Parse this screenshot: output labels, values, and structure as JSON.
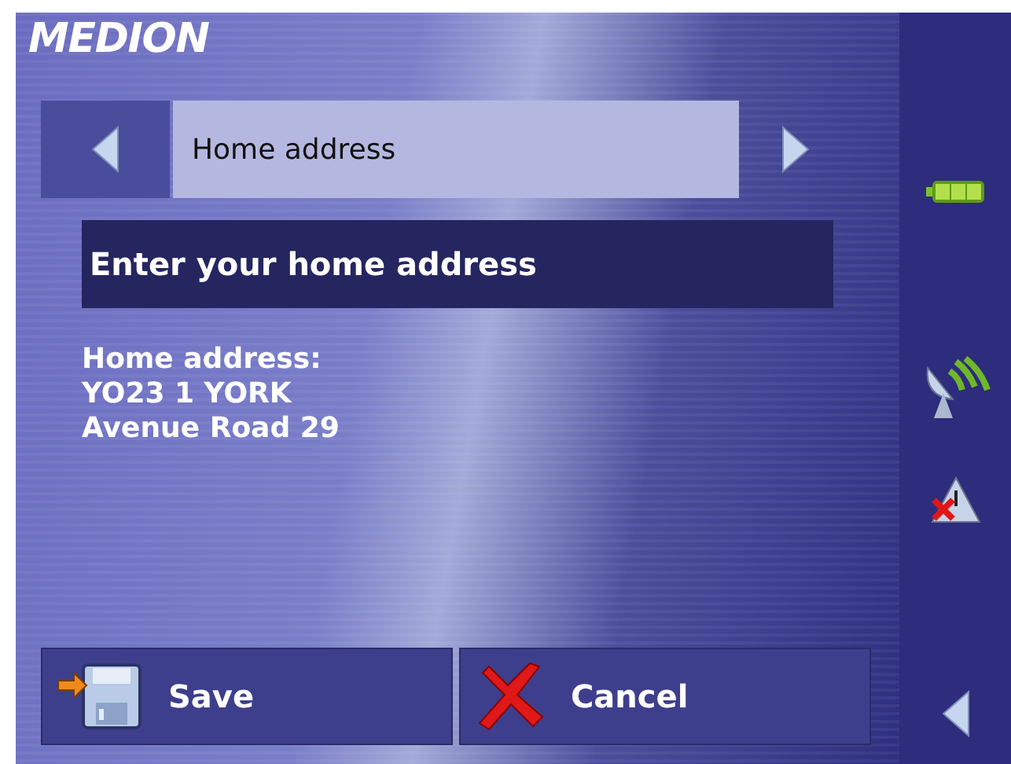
{
  "logo": "MEDION",
  "selector": {
    "label": "Home address"
  },
  "heading": "Enter your home address",
  "address_lines": [
    "Home address:",
    "YO23 1 YORK",
    "Avenue Road 29"
  ],
  "buttons": [
    {
      "kind": "save",
      "label": "Save"
    },
    {
      "kind": "cancel",
      "label": "Cancel"
    }
  ]
}
